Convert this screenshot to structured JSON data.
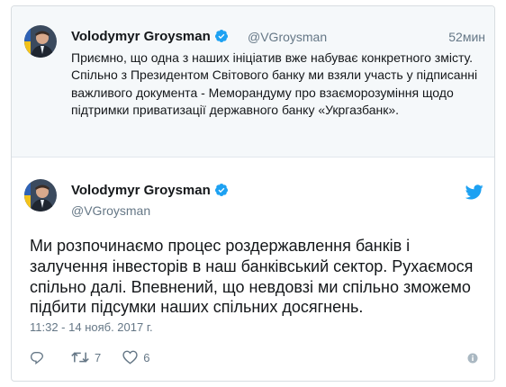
{
  "quoted_tweet": {
    "author_name": "Volodymyr Groysman",
    "author_handle": "@VGroysman",
    "time": "52мин",
    "text": "Приємно, що одна з наших ініціатив вже набуває конкретного змісту. Спільно з Президентом Світового банку ми взяли участь у підписанні важливого документа - Меморандуму про взаєморозуміння щодо підтримки приватизації державного банку «Укргазбанк»."
  },
  "main_tweet": {
    "author_name": "Volodymyr Groysman",
    "author_handle": "@VGroysman",
    "text": "Ми розпочинаємо процес роздержавлення банків і залучення інвесторів в наш банківський сектор. Рухаємося спільно далі. Впевнений, що невдовзі ми спільно зможемо підбити підсумки наших спільних досягнень.",
    "timestamp": "11:32 - 14 нояб. 2017 г.",
    "actions": {
      "reply_icon": "reply-icon",
      "retweet_icon": "retweet-icon",
      "retweet_count": "7",
      "like_icon": "heart-icon",
      "like_count": "6"
    }
  },
  "icons": {
    "verified": "verified-badge-icon",
    "twitter": "twitter-bird-icon",
    "info": "info-icon"
  },
  "colors": {
    "verified_blue": "#1da1f2",
    "twitter_blue": "#1da1f2",
    "muted_text": "#657786",
    "quoted_bg": "#f5f8fa"
  }
}
